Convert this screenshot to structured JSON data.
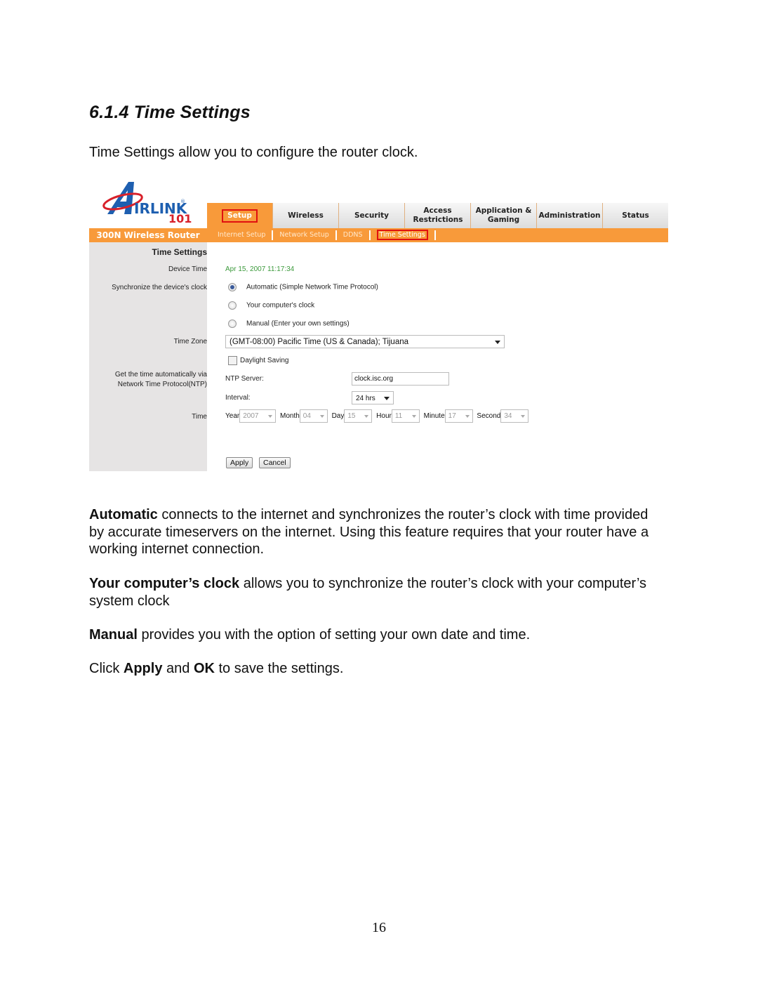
{
  "document": {
    "heading": "6.1.4 Time Settings",
    "intro": "Time Settings allow you to configure the router clock.",
    "page_number": "16",
    "paragraphs": [
      {
        "bold": "Automatic",
        "text": " connects to the internet and synchronizes the router’s clock with time provided by accurate timeservers on the internet.  Using this feature requires that your router have a working internet connection."
      },
      {
        "bold": "Your computer’s clock",
        "text": " allows you to synchronize the router’s clock with your computer’s system clock"
      },
      {
        "bold": "Manual",
        "text": " provides you with the option of setting your own date and time."
      }
    ],
    "final": {
      "pre": "Click ",
      "apply": "Apply",
      "mid": " and ",
      "ok": "OK",
      "post": " to save the settings."
    }
  },
  "router": {
    "logo": {
      "brand": "IRLINK",
      "model": "101",
      "icon": "airlink-logo"
    },
    "product_name": "300N Wireless Router",
    "colors": {
      "accent": "#f89a3a",
      "highlight": "#e01010",
      "device_time": "#3c9a3c",
      "logo_blue": "#1e5fb0",
      "logo_red": "#d8202a"
    },
    "tabs": [
      {
        "label": "Setup",
        "active": true
      },
      {
        "label": "Wireless",
        "active": false
      },
      {
        "label": "Security",
        "active": false
      },
      {
        "label": "Access Restrictions",
        "active": false
      },
      {
        "label": "Application & Gaming",
        "active": false
      },
      {
        "label": "Administration",
        "active": false
      },
      {
        "label": "Status",
        "active": false
      }
    ],
    "subtabs": [
      {
        "label": "Internet Setup",
        "active": false
      },
      {
        "label": "Network Setup",
        "active": false
      },
      {
        "label": "DDNS",
        "active": false
      },
      {
        "label": "Time Settings",
        "active": true
      }
    ],
    "labels": {
      "section": "Time Settings",
      "device_time": "Device Time",
      "sync": "Synchronize the device's clock",
      "time_zone": "Time Zone",
      "ntp_line1": "Get the time automatically via",
      "ntp_line2": "Network Time Protocol(NTP)",
      "time": "Time"
    },
    "device_time_value": "Apr 15, 2007 11:17:34",
    "sync_options": [
      {
        "label": "Automatic (Simple Network Time Protocol)",
        "checked": true
      },
      {
        "label": "Your computer's clock",
        "checked": false
      },
      {
        "label": "Manual (Enter your own settings)",
        "checked": false
      }
    ],
    "time_zone_value": "(GMT-08:00) Pacific Time (US & Canada); Tijuana",
    "daylight_saving": {
      "label": "Daylight Saving",
      "checked": false
    },
    "ntp_server": {
      "label": "NTP Server:",
      "value": "clock.isc.org"
    },
    "interval": {
      "label": "Interval:",
      "value": "24 hrs"
    },
    "time_fields": [
      {
        "label": "Year",
        "value": "2007"
      },
      {
        "label": "Month",
        "value": "04"
      },
      {
        "label": "Day",
        "value": "15"
      },
      {
        "label": "Hour",
        "value": "11"
      },
      {
        "label": "Minute",
        "value": "17"
      },
      {
        "label": "Second",
        "value": "34"
      }
    ],
    "buttons": {
      "apply": "Apply",
      "cancel": "Cancel"
    }
  }
}
